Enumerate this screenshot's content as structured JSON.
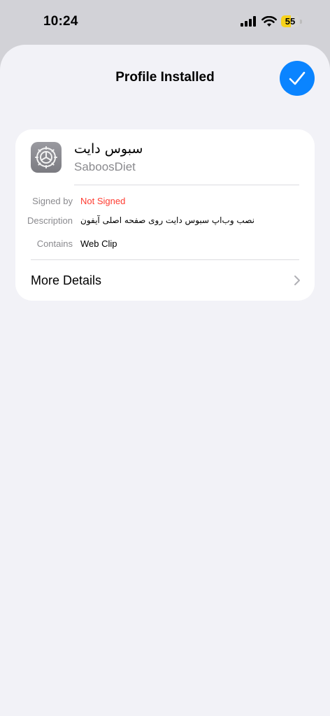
{
  "status_bar": {
    "time": "10:24",
    "battery_level": "55",
    "battery_fraction": 0.55
  },
  "sheet": {
    "title": "Profile Installed",
    "done_icon": "checkmark-icon",
    "accent": "#0a84ff"
  },
  "profile": {
    "name": "سبوس دایت",
    "subtitle": "SaboosDiet",
    "icon": "settings-gear-icon"
  },
  "details": [
    {
      "label": "Signed by",
      "value": "Not Signed",
      "status_color": "#ff3b30"
    },
    {
      "label": "Description",
      "value": "نصب وب‌اپ سبوس دایت روی صفحه اصلی آیفون"
    },
    {
      "label": "Contains",
      "value": "Web Clip"
    }
  ],
  "more_details": {
    "label": "More Details",
    "icon": "chevron-right-icon"
  }
}
